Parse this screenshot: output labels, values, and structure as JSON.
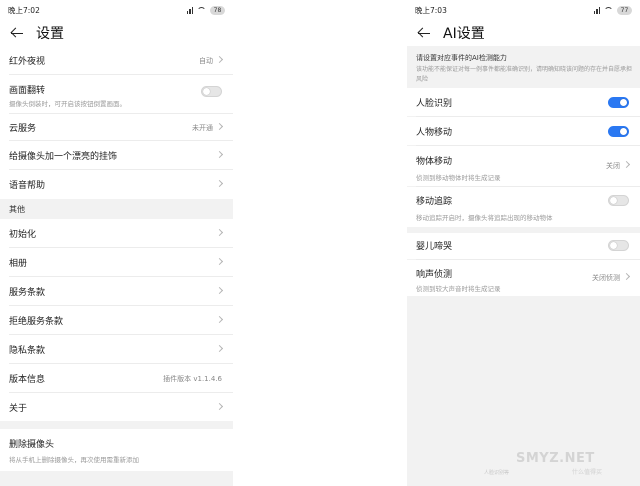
{
  "left": {
    "status": {
      "time": "晚上7:02",
      "battery": "78"
    },
    "title": "设置",
    "rows": [
      {
        "label": "红外夜视",
        "value": "自动"
      },
      {
        "label": "画面翻转",
        "sub": "摄像头倒装时，可开启该按钮倒置画面。",
        "toggle": "off"
      },
      {
        "label": "云服务",
        "value": "未开通"
      },
      {
        "label": "给摄像头加一个漂亮的挂饰"
      },
      {
        "label": "语音帮助"
      }
    ],
    "section_other": "其他",
    "other_rows": [
      {
        "label": "初始化"
      },
      {
        "label": "相册"
      },
      {
        "label": "服务条款"
      },
      {
        "label": "拒绝服务条款"
      },
      {
        "label": "隐私条款"
      },
      {
        "label": "版本信息",
        "value": "插件版本 v1.1.4.6"
      },
      {
        "label": "关于"
      }
    ],
    "delete": {
      "label": "删除摄像头",
      "sub": "将从手机上删除摄像头，再次使用需重新添加"
    }
  },
  "right": {
    "status": {
      "time": "晚上7:03",
      "battery": "77"
    },
    "title": "AI设置",
    "notice_heading": "请设置对应事件的AI检测能力",
    "notice_body": "该功能不能保证对每一例事件都能准确识别，请明确知晓该问题的存在并自愿承担风险",
    "rows": [
      {
        "label": "人脸识别",
        "toggle": "on"
      },
      {
        "label": "人物移动",
        "toggle": "on"
      },
      {
        "label": "物体移动",
        "value": "关闭",
        "sub": "侦测到移动物体时将生成记录"
      },
      {
        "label": "移动追踪",
        "sub": "移动追踪开启时，摄像头将追踪出现的移动物体",
        "toggle": "off"
      },
      {
        "label": "婴儿啼哭",
        "toggle": "off"
      },
      {
        "label": "响声侦测",
        "value": "关闭侦测",
        "sub": "侦测到较大声音时将生成记录"
      }
    ]
  },
  "watermark": {
    "main": "SMYZ.NET",
    "sub": "什么值得买",
    "footnote": "人脸识别等"
  },
  "colors": {
    "accent": "#2a78f2",
    "section_bg": "#f2f2f2"
  }
}
